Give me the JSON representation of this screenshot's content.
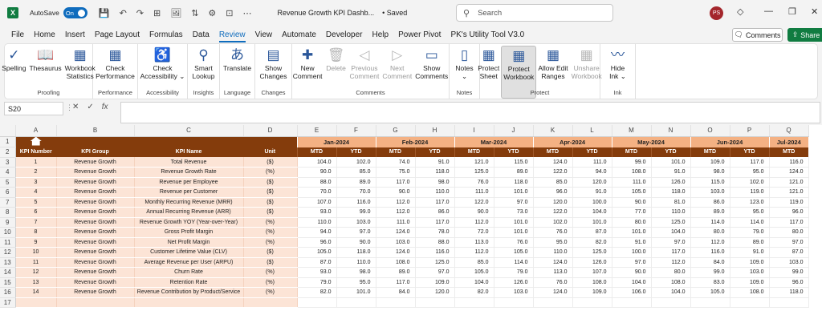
{
  "titlebar": {
    "app_logo": "X",
    "autosave_label": "AutoSave",
    "autosave_state": "On",
    "doc_title": "Revenue Growth KPI Dashb...",
    "save_status": "• Saved",
    "search_placeholder": "Search",
    "avatar_initials": "PS"
  },
  "tabs": [
    "File",
    "Home",
    "Insert",
    "Page Layout",
    "Formulas",
    "Data",
    "Review",
    "View",
    "Automate",
    "Developer",
    "Help",
    "Power Pivot",
    "PK's Utility Tool V3.0"
  ],
  "active_tab": "Review",
  "top_buttons": {
    "comments": "Comments",
    "share": "Share"
  },
  "ribbon": [
    {
      "label": "Proofing",
      "buttons": [
        {
          "text": "Spelling",
          "icon": "spelling-icon",
          "glyph": "✓"
        },
        {
          "text": "Thesaurus",
          "icon": "thesaurus-icon",
          "glyph": "📖"
        },
        {
          "text": "Workbook\nStatistics",
          "icon": "statistics-icon",
          "glyph": "▦"
        }
      ]
    },
    {
      "label": "Performance",
      "buttons": [
        {
          "text": "Check\nPerformance",
          "icon": "performance-icon",
          "glyph": "▦"
        }
      ]
    },
    {
      "label": "Accessibility",
      "buttons": [
        {
          "text": "Check\nAccessibility ⌄",
          "icon": "accessibility-icon",
          "glyph": "♿"
        }
      ]
    },
    {
      "label": "Insights",
      "buttons": [
        {
          "text": "Smart\nLookup",
          "icon": "lookup-icon",
          "glyph": "⚲"
        }
      ]
    },
    {
      "label": "Language",
      "buttons": [
        {
          "text": "Translate",
          "icon": "translate-icon",
          "glyph": "あ"
        }
      ]
    },
    {
      "label": "Changes",
      "buttons": [
        {
          "text": "Show\nChanges",
          "icon": "changes-icon",
          "glyph": "▤"
        }
      ]
    },
    {
      "label": "Comments",
      "buttons": [
        {
          "text": "New\nComment",
          "icon": "new-comment-icon",
          "glyph": "✚"
        },
        {
          "text": "Delete",
          "icon": "delete-icon",
          "glyph": "🗑",
          "disabled": true
        },
        {
          "text": "Previous\nComment",
          "icon": "previous-icon",
          "glyph": "◁",
          "disabled": true
        },
        {
          "text": "Next\nComment",
          "icon": "next-icon",
          "glyph": "▷",
          "disabled": true
        },
        {
          "text": "Show\nComments",
          "icon": "show-comments-icon",
          "glyph": "▭"
        }
      ]
    },
    {
      "label": "Notes",
      "buttons": [
        {
          "text": "Notes\n⌄",
          "icon": "notes-icon",
          "glyph": "▯"
        }
      ]
    },
    {
      "label": "Protect",
      "buttons": [
        {
          "text": "Protect\nSheet",
          "icon": "protect-sheet-icon",
          "glyph": "▦"
        },
        {
          "text": "Protect\nWorkbook",
          "icon": "protect-workbook-icon",
          "glyph": "▦",
          "selected": true
        },
        {
          "text": "Allow Edit\nRanges",
          "icon": "allow-edit-icon",
          "glyph": "▦"
        },
        {
          "text": "Unshare\nWorkbook",
          "icon": "unshare-icon",
          "glyph": "▦",
          "disabled": true
        }
      ]
    },
    {
      "label": "Ink",
      "buttons": [
        {
          "text": "Hide\nInk ⌄",
          "icon": "ink-icon",
          "glyph": "〰"
        }
      ]
    }
  ],
  "formula_bar": {
    "name_box": "S20",
    "cancel": "✕",
    "enter": "✓",
    "fx": "fx",
    "value": ""
  },
  "columns": [
    "A",
    "B",
    "C",
    "D",
    "E",
    "F",
    "G",
    "H",
    "I",
    "J",
    "K",
    "L",
    "M",
    "N",
    "O",
    "P",
    "Q"
  ],
  "header_row2": {
    "kpi_number": "KPI Number",
    "kpi_group": "KPI Group",
    "kpi_name": "KPI Name",
    "unit": "Unit",
    "mtd": "MTD",
    "ytd": "YTD"
  },
  "months": [
    "Jan-2024",
    "Feb-2024",
    "Mar-2024",
    "Apr-2024",
    "May-2024",
    "Jun-2024",
    "Jul-2024"
  ],
  "rows": [
    {
      "no": "1",
      "group": "Revenue Growth",
      "name": "Total Revenue",
      "unit": "($)",
      "vals": [
        "104.0",
        "102.0",
        "74.0",
        "91.0",
        "121.0",
        "115.0",
        "124.0",
        "111.0",
        "99.0",
        "101.0",
        "109.0",
        "117.0",
        "116.0"
      ]
    },
    {
      "no": "2",
      "group": "Revenue Growth",
      "name": "Revenue Growth Rate",
      "unit": "(%)",
      "vals": [
        "90.0",
        "85.0",
        "75.0",
        "118.0",
        "125.0",
        "89.0",
        "122.0",
        "94.0",
        "108.0",
        "91.0",
        "98.0",
        "95.0",
        "124.0"
      ]
    },
    {
      "no": "3",
      "group": "Revenue Growth",
      "name": "Revenue per Employee",
      "unit": "($)",
      "vals": [
        "88.0",
        "89.0",
        "117.0",
        "98.0",
        "76.0",
        "118.0",
        "85.0",
        "120.0",
        "111.0",
        "126.0",
        "115.0",
        "102.0",
        "121.0"
      ]
    },
    {
      "no": "4",
      "group": "Revenue Growth",
      "name": "Revenue per Customer",
      "unit": "($)",
      "vals": [
        "70.0",
        "70.0",
        "90.0",
        "110.0",
        "111.0",
        "101.0",
        "96.0",
        "91.0",
        "105.0",
        "118.0",
        "103.0",
        "119.0",
        "121.0"
      ]
    },
    {
      "no": "5",
      "group": "Revenue Growth",
      "name": "Monthly Recurring Revenue (MRR)",
      "unit": "($)",
      "vals": [
        "107.0",
        "116.0",
        "112.0",
        "117.0",
        "122.0",
        "97.0",
        "120.0",
        "100.0",
        "90.0",
        "81.0",
        "86.0",
        "123.0",
        "119.0"
      ]
    },
    {
      "no": "6",
      "group": "Revenue Growth",
      "name": "Annual Recurring Revenue (ARR)",
      "unit": "($)",
      "vals": [
        "93.0",
        "99.0",
        "112.0",
        "86.0",
        "90.0",
        "73.0",
        "122.0",
        "104.0",
        "77.0",
        "110.0",
        "89.0",
        "95.0",
        "96.0"
      ]
    },
    {
      "no": "7",
      "group": "Revenue Growth",
      "name": "Revenue Growth YOY (Year-over-Year)",
      "unit": "(%)",
      "vals": [
        "110.0",
        "103.0",
        "111.0",
        "117.0",
        "112.0",
        "101.0",
        "102.0",
        "101.0",
        "80.0",
        "125.0",
        "114.0",
        "114.0",
        "117.0"
      ]
    },
    {
      "no": "8",
      "group": "Revenue Growth",
      "name": "Gross Profit Margin",
      "unit": "(%)",
      "vals": [
        "94.0",
        "97.0",
        "124.0",
        "78.0",
        "72.0",
        "101.0",
        "76.0",
        "87.0",
        "101.0",
        "104.0",
        "80.0",
        "79.0",
        "80.0"
      ]
    },
    {
      "no": "9",
      "group": "Revenue Growth",
      "name": "Net Profit Margin",
      "unit": "(%)",
      "vals": [
        "96.0",
        "90.0",
        "103.0",
        "88.0",
        "113.0",
        "76.0",
        "95.0",
        "82.0",
        "91.0",
        "97.0",
        "112.0",
        "89.0",
        "97.0"
      ]
    },
    {
      "no": "10",
      "group": "Revenue Growth",
      "name": "Customer Lifetime Value (CLV)",
      "unit": "($)",
      "vals": [
        "105.0",
        "118.0",
        "124.0",
        "116.0",
        "112.0",
        "105.0",
        "110.0",
        "125.0",
        "100.0",
        "117.0",
        "116.0",
        "91.0",
        "87.0"
      ]
    },
    {
      "no": "11",
      "group": "Revenue Growth",
      "name": "Average Revenue per User (ARPU)",
      "unit": "($)",
      "vals": [
        "87.0",
        "110.0",
        "108.0",
        "125.0",
        "85.0",
        "114.0",
        "124.0",
        "126.0",
        "97.0",
        "112.0",
        "84.0",
        "109.0",
        "103.0"
      ]
    },
    {
      "no": "12",
      "group": "Revenue Growth",
      "name": "Churn Rate",
      "unit": "(%)",
      "vals": [
        "93.0",
        "98.0",
        "89.0",
        "97.0",
        "105.0",
        "79.0",
        "113.0",
        "107.0",
        "90.0",
        "80.0",
        "99.0",
        "103.0",
        "99.0"
      ]
    },
    {
      "no": "13",
      "group": "Revenue Growth",
      "name": "Retention Rate",
      "unit": "(%)",
      "vals": [
        "79.0",
        "95.0",
        "117.0",
        "109.0",
        "104.0",
        "126.0",
        "76.0",
        "108.0",
        "104.0",
        "108.0",
        "83.0",
        "109.0",
        "96.0"
      ]
    },
    {
      "no": "14",
      "group": "Revenue Growth",
      "name": "Revenue Contribution by Product/Service",
      "unit": "(%)",
      "vals": [
        "82.0",
        "101.0",
        "84.0",
        "120.0",
        "82.0",
        "103.0",
        "124.0",
        "109.0",
        "106.0",
        "104.0",
        "105.0",
        "108.0",
        "118.0"
      ]
    }
  ]
}
